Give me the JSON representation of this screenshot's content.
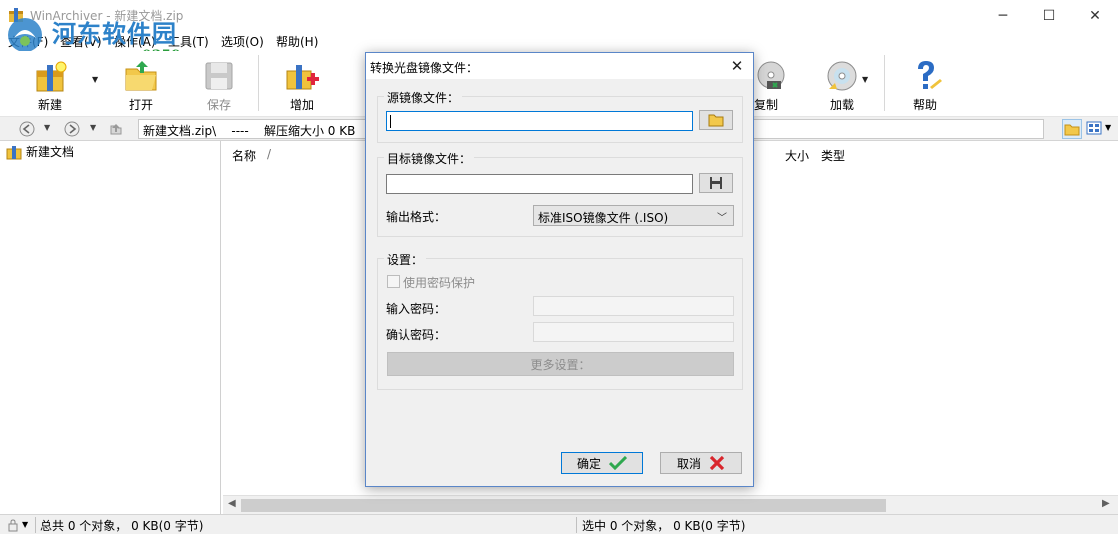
{
  "window": {
    "title": "WinArchiver - 新建文档.zip",
    "controls": {
      "minimize": "─",
      "maximize": "☐",
      "close": "✕"
    }
  },
  "watermark": {
    "site_name": "河东软件园",
    "url": "www.pc0359.cn"
  },
  "menu": [
    "文件(F)",
    "查看(V)",
    "操作(A)",
    "工具(T)",
    "选项(O)",
    "帮助(H)"
  ],
  "toolbar": {
    "new": "新建",
    "open": "打开",
    "save": "保存",
    "add": "增加",
    "copy": "复制",
    "mount": "加载",
    "help": "帮助"
  },
  "address": {
    "path": "新建文档.zip\\    ----    解压缩大小 0 KB  （0"
  },
  "tree": {
    "root": "新建文档"
  },
  "columns": {
    "name": "名称",
    "sort_indicator": "/",
    "size": "大小",
    "type": "类型"
  },
  "status": {
    "total": "总共 0 个对象， 0 KB(0 字节)",
    "selected": "选中 0 个对象， 0 KB(0 字节)"
  },
  "dialog": {
    "title": "转换光盘镜像文件：",
    "close": "✕",
    "source_group": "源镜像文件：",
    "source_value": "",
    "target_group": "目标镜像文件：",
    "target_value": "",
    "output_format_label": "输出格式：",
    "output_format_value": "标准ISO镜像文件 (.ISO)",
    "settings_group": "设置：",
    "use_password": "使用密码保护",
    "enter_password": "输入密码：",
    "confirm_password": "确认密码：",
    "more_settings": "更多设置：",
    "ok": "确定",
    "cancel": "取消"
  },
  "colors": {
    "accent": "#0078d7",
    "ok_check": "#2fa84f",
    "cancel_x": "#d9262c",
    "watermark_blue": "#2d82c9",
    "watermark_green": "#2a9d3c"
  }
}
